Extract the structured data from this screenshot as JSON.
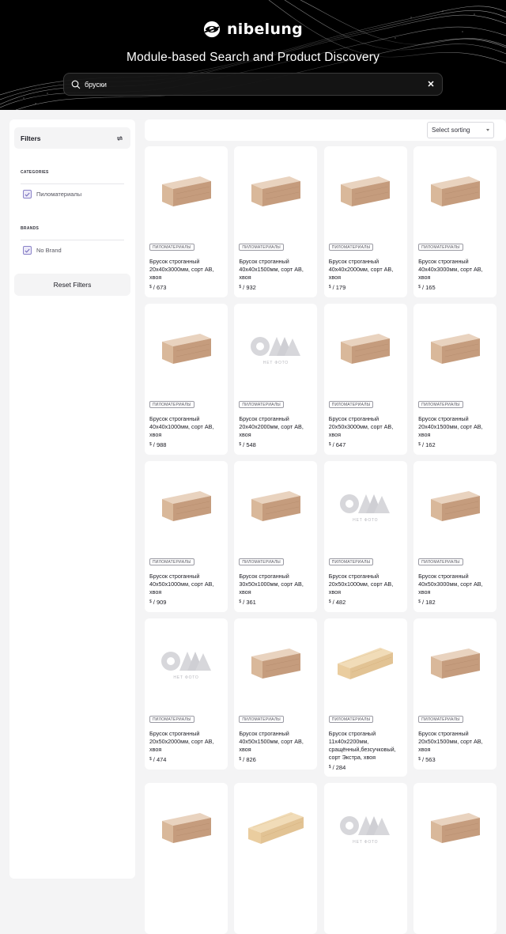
{
  "brand": {
    "name": "nibelung"
  },
  "hero": {
    "tagline": "Module-based Search and Product Discovery"
  },
  "search": {
    "value": "бруски",
    "placeholder": ""
  },
  "filters": {
    "title": "Filters",
    "categories_title": "CATEGORIES",
    "category_option": "Пиломатериалы",
    "brands_title": "BRANDS",
    "brand_option": "No Brand",
    "reset_label": "Reset Filters"
  },
  "sorting": {
    "label": "Select sorting"
  },
  "products": [
    {
      "badge": "ПИЛОМАТЕРИАЛЫ",
      "title": "Брусок строганный 20x40x3000мм, сорт АВ, хвоя",
      "currency": "$",
      "price": "673",
      "image": "beam"
    },
    {
      "badge": "ПИЛОМАТЕРИАЛЫ",
      "title": "Брусок строганный 40x40x1500мм, сорт АВ, хвоя",
      "currency": "$",
      "price": "932",
      "image": "beam"
    },
    {
      "badge": "ПИЛОМАТЕРИАЛЫ",
      "title": "Брусок строганный 40x40x2000мм, сорт АВ, хвоя",
      "currency": "$",
      "price": "179",
      "image": "beam"
    },
    {
      "badge": "ПИЛОМАТЕРИАЛЫ",
      "title": "Брусок строганный 40x40x3000мм, сорт АВ, хвоя",
      "currency": "$",
      "price": "165",
      "image": "beam"
    },
    {
      "badge": "ПИЛОМАТЕРИАЛЫ",
      "title": "Брусок строганный 40x40x1000мм, сорт АВ, хвоя",
      "currency": "$",
      "price": "988",
      "image": "beam"
    },
    {
      "badge": "ПИЛОМАТЕРИАЛЫ",
      "title": "Брусок строганный 20x40x2000мм, сорт АВ, хвоя",
      "currency": "$",
      "price": "548",
      "image": "nophoto",
      "nophoto_text": "НЕТ ФОТО"
    },
    {
      "badge": "ПИЛОМАТЕРИАЛЫ",
      "title": "Брусок строганный 20x50x3000мм, сорт АВ, хвоя",
      "currency": "$",
      "price": "647",
      "image": "beam"
    },
    {
      "badge": "ПИЛОМАТЕРИАЛЫ",
      "title": "Брусок строганный 20x40x1500мм, сорт АВ, хвоя",
      "currency": "$",
      "price": "162",
      "image": "beam"
    },
    {
      "badge": "ПИЛОМАТЕРИАЛЫ",
      "title": "Брусок строганный 40x50x1000мм, сорт АВ, хвоя",
      "currency": "$",
      "price": "909",
      "image": "beam"
    },
    {
      "badge": "ПИЛОМАТЕРИАЛЫ",
      "title": "Брусок строганный 30x50x1000мм, сорт АВ, хвоя",
      "currency": "$",
      "price": "361",
      "image": "beam"
    },
    {
      "badge": "ПИЛОМАТЕРИАЛЫ",
      "title": "Брусок строганный 20x50x1000мм, сорт АВ, хвоя",
      "currency": "$",
      "price": "482",
      "image": "nophoto",
      "nophoto_text": "НЕТ ФОТО"
    },
    {
      "badge": "ПИЛОМАТЕРИАЛЫ",
      "title": "Брусок строганный 40x50x3000мм, сорт АВ, хвоя",
      "currency": "$",
      "price": "182",
      "image": "beam"
    },
    {
      "badge": "ПИЛОМАТЕРИАЛЫ",
      "title": "Брусок строганный 20x50x2000мм, сорт АВ, хвоя",
      "currency": "$",
      "price": "474",
      "image": "nophoto",
      "nophoto_text": "НЕТ ФОТО"
    },
    {
      "badge": "ПИЛОМАТЕРИАЛЫ",
      "title": "Брусок строганный 40x50x1500мм, сорт АВ, хвоя",
      "currency": "$",
      "price": "826",
      "image": "beam"
    },
    {
      "badge": "ПИЛОМАТЕРИАЛЫ",
      "title": "Брусок строганый 11x40x2200мм, сращённый,безсучковый, сорт Экстра, хвоя",
      "currency": "$",
      "price": "284",
      "image": "board"
    },
    {
      "badge": "ПИЛОМАТЕРИАЛЫ",
      "title": "Брусок строганный 20x50x1500мм, сорт АВ, хвоя",
      "currency": "$",
      "price": "563",
      "image": "beam"
    },
    {
      "image": "beam"
    },
    {
      "image": "board"
    },
    {
      "image": "nophoto",
      "nophoto_text": "НЕТ ФОТО"
    },
    {
      "image": "beam"
    }
  ]
}
